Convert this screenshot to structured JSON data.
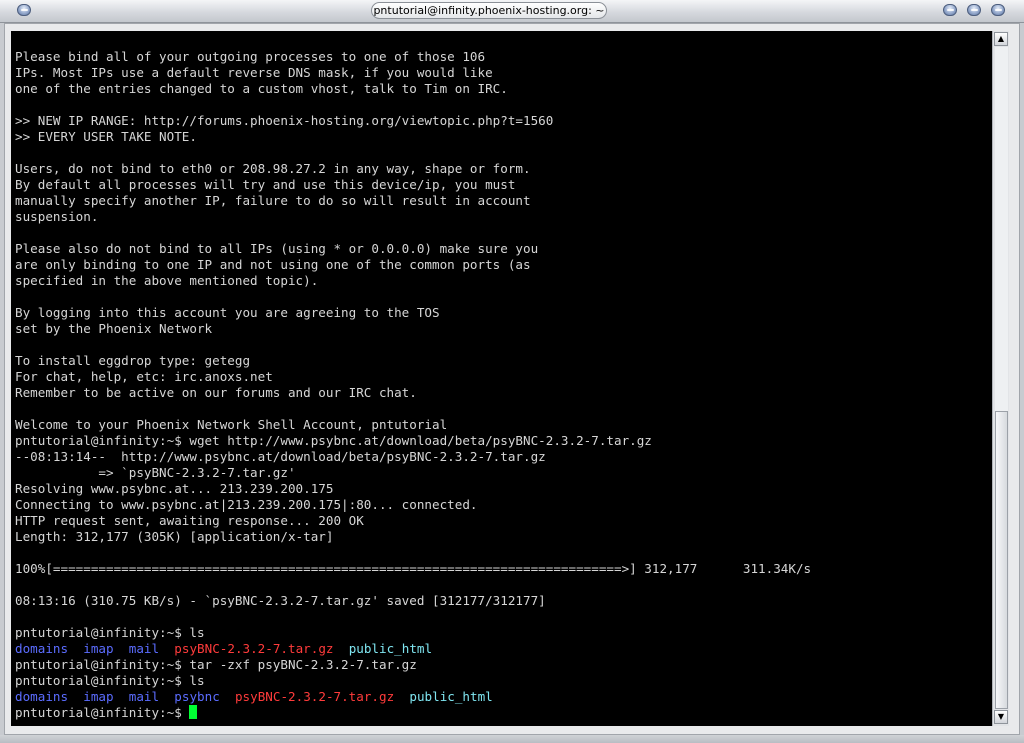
{
  "window": {
    "title": "pntutorial@infinity.phoenix-hosting.org: ~"
  },
  "terminal": {
    "lines": [
      "Please bind all of your outgoing processes to one of those 106",
      "IPs. Most IPs use a default reverse DNS mask, if you would like",
      "one of the entries changed to a custom vhost, talk to Tim on IRC.",
      "",
      ">> NEW IP RANGE: http://forums.phoenix-hosting.org/viewtopic.php?t=1560",
      ">> EVERY USER TAKE NOTE.",
      "",
      "Users, do not bind to eth0 or 208.98.27.2 in any way, shape or form.",
      "By default all processes will try and use this device/ip, you must",
      "manually specify another IP, failure to do so will result in account",
      "suspension.",
      "",
      "Please also do not bind to all IPs (using * or 0.0.0.0) make sure you",
      "are only binding to one IP and not using one of the common ports (as",
      "specified in the above mentioned topic).",
      "",
      "By logging into this account you are agreeing to the TOS",
      "set by the Phoenix Network",
      "",
      "To install eggdrop type: getegg",
      "For chat, help, etc: irc.anoxs.net",
      "Remember to be active on our forums and our IRC chat.",
      "",
      "Welcome to your Phoenix Network Shell Account, pntutorial",
      "pntutorial@infinity:~$ wget http://www.psybnc.at/download/beta/psyBNC-2.3.2-7.tar.gz",
      "--08:13:14--  http://www.psybnc.at/download/beta/psyBNC-2.3.2-7.tar.gz",
      "           => `psyBNC-2.3.2-7.tar.gz'",
      "Resolving www.psybnc.at... 213.239.200.175",
      "Connecting to www.psybnc.at|213.239.200.175|:80... connected.",
      "HTTP request sent, awaiting response... 200 OK",
      "Length: 312,177 (305K) [application/x-tar]",
      "",
      "100%[===========================================================================>] 312,177      311.34K/s",
      "",
      "08:13:16 (310.75 KB/s) - `psyBNC-2.3.2-7.tar.gz' saved [312177/312177]",
      "",
      "pntutorial@infinity:~$ ls"
    ],
    "ls1": {
      "domains": "domains",
      "imap": "imap",
      "mail": "mail",
      "tarball": "psyBNC-2.3.2-7.tar.gz",
      "public_html": "public_html"
    },
    "cmd_tar": "pntutorial@infinity:~$ tar -zxf psyBNC-2.3.2-7.tar.gz",
    "cmd_ls2": "pntutorial@infinity:~$ ls",
    "ls2": {
      "domains": "domains",
      "imap": "imap",
      "mail": "mail",
      "psybnc": "psybnc",
      "tarball": "psyBNC-2.3.2-7.tar.gz",
      "public_html": "public_html"
    },
    "prompt": "pntutorial@infinity:~$ ",
    "colors": {
      "background": "#000000",
      "text": "#d6d6d6",
      "directory": "#5b6cff",
      "archive": "#ff3b3b",
      "link_dir": "#7fe5f0",
      "cursor": "#00ff33"
    }
  },
  "scrollbar": {
    "position_fraction": 0.55,
    "visible_fraction": 0.45,
    "up_icon": "arrow-up-icon",
    "down_icon": "arrow-down-icon"
  }
}
